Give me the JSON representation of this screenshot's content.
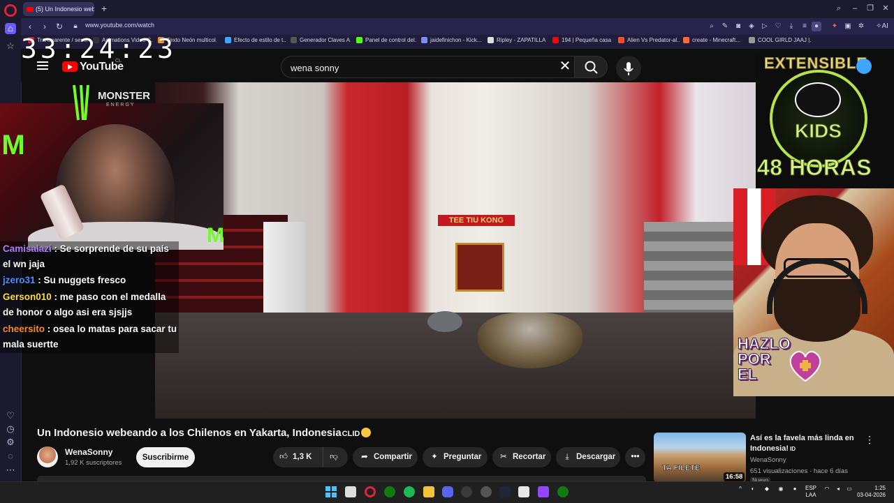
{
  "browser": {
    "tab_title": "(5) Un Indonesio web",
    "url": "www.youtube.com/watch",
    "ai_label": "AI",
    "bookmarks": [
      "Transparente / semi...",
      "Animations Video C...",
      "Texto Neón multicol...",
      "Efecto de estilo de t...",
      "Generador Claves A...",
      "Panel de control del...",
      "jaidefinichon - Kick...",
      "Ripley - ZAPATILLA...",
      "194 | Pequeña casa...",
      "Alien Vs Predator-al...",
      "create - Minecraft...",
      "COOL GIRLD JAAJ |..."
    ]
  },
  "youtube": {
    "logo_text": "YouTube",
    "country_code": "CL",
    "search_value": "wena sonny"
  },
  "overlay": {
    "timer": "33:24:23",
    "monster_brand": "MONSTER",
    "monster_sub": "ENERGY",
    "extensible": "EXTENSIBLE",
    "kids": "KIDS",
    "horas": "48 HORAS",
    "hazlo_line1": "HAZLO",
    "hazlo_line2": "POR",
    "hazlo_line3": "EL",
    "chat": [
      {
        "user": "Camisalazi",
        "text": " : Se sorprende de su país el wn jaja",
        "color": "#b57cff"
      },
      {
        "user": "jzero31",
        "text": " : Su nuggets fresco",
        "color": "#4a90ff"
      },
      {
        "user": "Gerson010",
        "text": " : me paso con el medalla de honor o algo asi era sjsjjs",
        "color": "#ffe030"
      },
      {
        "user": "cheersito",
        "text": " : osea lo matas para sacar tu mala suertte",
        "color": "#ff8a2a"
      }
    ]
  },
  "video": {
    "scene_sign": "TEE TIU KONG",
    "title": "Un Indonesio webeando a los Chilenos en Yakarta, Indonesia",
    "title_suffix": "CLID",
    "channel_name": "WenaSonny",
    "subscribers": "1,92 K suscriptores",
    "subscribe_label": "Suscribirme",
    "like_count": "1,3 K",
    "share_label": "Compartir",
    "ask_label": "Preguntar",
    "clip_label": "Recortar",
    "download_label": "Descargar"
  },
  "recommended": {
    "title": "Así es la favela más linda en Indonesia!",
    "title_suffix": "ID",
    "thumb_text": "TA FILETE",
    "duration": "16:58",
    "channel": "WenaSonny",
    "meta": "651 visualizaciones · hace 6 días",
    "badge": "Nuevo"
  },
  "taskbar": {
    "lang": "ESP",
    "region": "LAA",
    "time": "1:25",
    "date": "03-04-2026"
  },
  "colors": {
    "yt_red": "#ff0000",
    "opera_red": "#e0233b",
    "accent_purple": "#6a5cff"
  }
}
